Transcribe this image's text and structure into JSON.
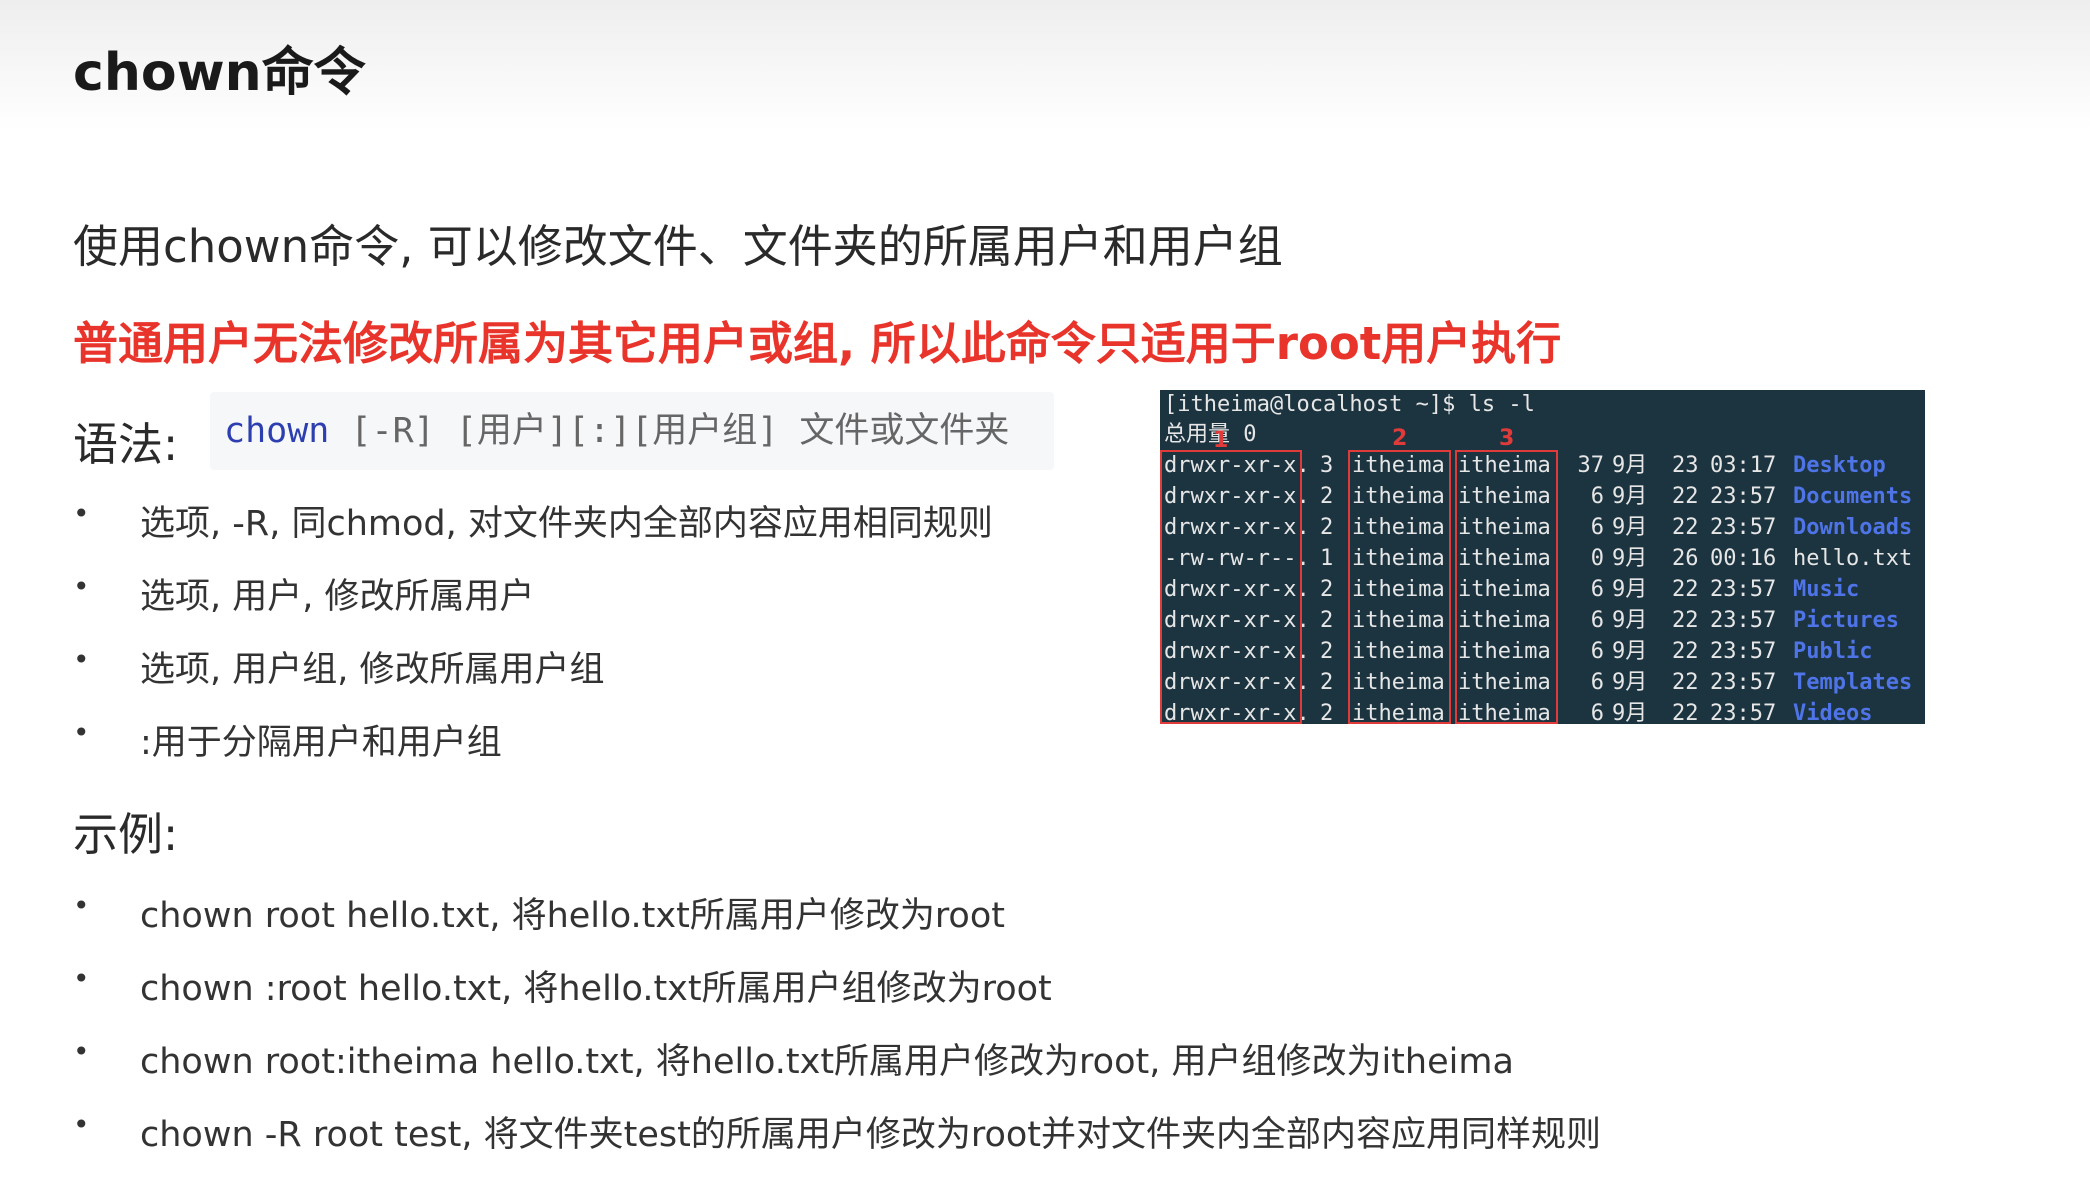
{
  "title": "chown命令",
  "intro": "使用chown命令, 可以修改文件、文件夹的所属用户和用户组",
  "warning": "普通用户无法修改所属为其它用户或组, 所以此命令只适用于root用户执行",
  "syntax": {
    "label": "语法:",
    "command": "chown",
    "args": " [-R] [用户][:][用户组] 文件或文件夹"
  },
  "options": [
    "选项, -R, 同chmod, 对文件夹内全部内容应用相同规则",
    "选项, 用户, 修改所属用户",
    "选项, 用户组, 修改所属用户组",
    ":用于分隔用户和用户组"
  ],
  "examples_label": "示例:",
  "examples": [
    "chown root hello.txt, 将hello.txt所属用户修改为root",
    "chown :root hello.txt, 将hello.txt所属用户组修改为root",
    "chown root:itheima hello.txt, 将hello.txt所属用户修改为root, 用户组修改为itheima",
    "chown -R root test, 将文件夹test的所属用户修改为root并对文件夹内全部内容应用同样规则"
  ],
  "bullet_glyph": "•",
  "terminal": {
    "prompt": "[itheima@localhost ~]$ ls -l",
    "total": "总用量 0",
    "markers": [
      "1",
      "2",
      "3"
    ],
    "rows": [
      {
        "perm": "drwxr-xr-x.",
        "links": "3",
        "user": "itheima",
        "group": "itheima",
        "size": "37",
        "month": "9月",
        "day": "23",
        "time": "03:17",
        "name": "Desktop",
        "type": "dir"
      },
      {
        "perm": "drwxr-xr-x.",
        "links": "2",
        "user": "itheima",
        "group": "itheima",
        "size": "6",
        "month": "9月",
        "day": "22",
        "time": "23:57",
        "name": "Documents",
        "type": "dir"
      },
      {
        "perm": "drwxr-xr-x.",
        "links": "2",
        "user": "itheima",
        "group": "itheima",
        "size": "6",
        "month": "9月",
        "day": "22",
        "time": "23:57",
        "name": "Downloads",
        "type": "dir"
      },
      {
        "perm": "-rw-rw-r--.",
        "links": "1",
        "user": "itheima",
        "group": "itheima",
        "size": "0",
        "month": "9月",
        "day": "26",
        "time": "00:16",
        "name": "hello.txt",
        "type": "file"
      },
      {
        "perm": "drwxr-xr-x.",
        "links": "2",
        "user": "itheima",
        "group": "itheima",
        "size": "6",
        "month": "9月",
        "day": "22",
        "time": "23:57",
        "name": "Music",
        "type": "dir"
      },
      {
        "perm": "drwxr-xr-x.",
        "links": "2",
        "user": "itheima",
        "group": "itheima",
        "size": "6",
        "month": "9月",
        "day": "22",
        "time": "23:57",
        "name": "Pictures",
        "type": "dir"
      },
      {
        "perm": "drwxr-xr-x.",
        "links": "2",
        "user": "itheima",
        "group": "itheima",
        "size": "6",
        "month": "9月",
        "day": "22",
        "time": "23:57",
        "name": "Public",
        "type": "dir"
      },
      {
        "perm": "drwxr-xr-x.",
        "links": "2",
        "user": "itheima",
        "group": "itheima",
        "size": "6",
        "month": "9月",
        "day": "22",
        "time": "23:57",
        "name": "Templates",
        "type": "dir"
      },
      {
        "perm": "drwxr-xr-x.",
        "links": "2",
        "user": "itheima",
        "group": "itheima",
        "size": "6",
        "month": "9月",
        "day": "22",
        "time": "23:57",
        "name": "Videos",
        "type": "dir"
      }
    ]
  },
  "colors": {
    "warning": "#e8342a",
    "command": "#2d3fb0",
    "terminal_bg": "#1c3440",
    "directory": "#4e74e8",
    "highlight_box": "#e03b3b"
  }
}
